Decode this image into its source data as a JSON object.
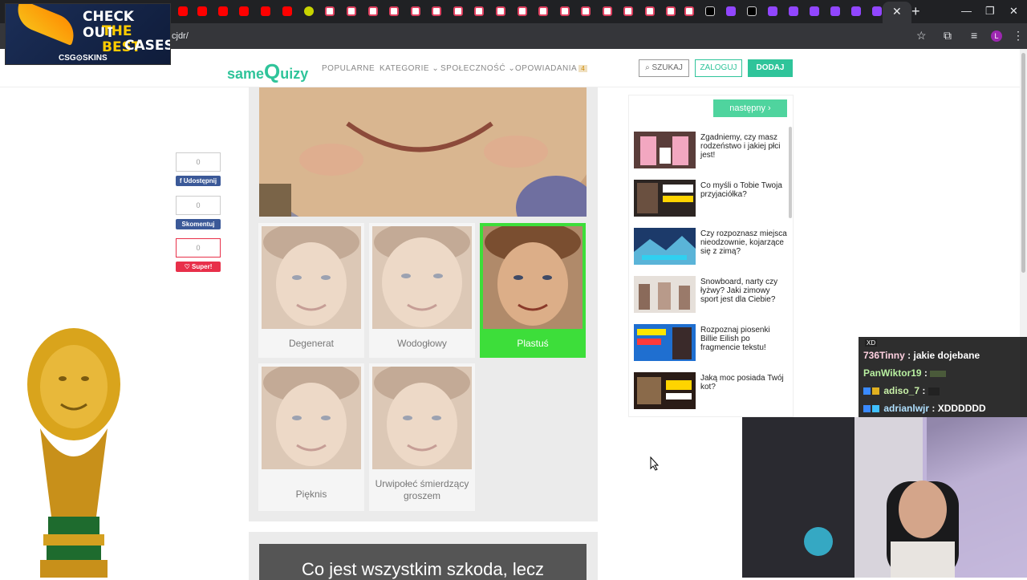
{
  "browser": {
    "url": "cjdr/",
    "profile_initial": "L",
    "tab_close": "✕",
    "new_tab": "+",
    "win_min": "—",
    "win_max": "❐",
    "win_close": "✕"
  },
  "ad": {
    "line1": "CHECK OUT",
    "line2": "THE BEST",
    "line3": "CASES",
    "brand": "CSG⊙SKINS"
  },
  "site": {
    "logo_small": "same",
    "logo_big": "Q",
    "logo_rest": "uizy",
    "nav": {
      "popular": "POPULARNE",
      "categories": "KATEGORIE",
      "community": "SPOŁECZNOŚĆ",
      "stories": "OPOWIADANIA",
      "stories_badge": "4"
    },
    "search": "SZUKAJ",
    "login": "ZALOGUJ",
    "add": "DODAJ"
  },
  "share": {
    "share_count": "0",
    "share_label": "Udostępnij",
    "comment_count": "0",
    "comment_label": "Skomentuj",
    "like_count": "0",
    "like_label": "Super!"
  },
  "quiz": {
    "answers": [
      {
        "label": "Degenerat",
        "selected": false
      },
      {
        "label": "Wodogłowy",
        "selected": false
      },
      {
        "label": "Plastuś",
        "selected": true
      },
      {
        "label": "Pięknis",
        "selected": false
      },
      {
        "label": "Urwipołeć śmierdzący groszem",
        "selected": false
      }
    ],
    "next_question_partial": "Co jest wszystkim szkoda, lecz"
  },
  "sidebar": {
    "next_button": "następny",
    "items": [
      {
        "title": "Zgadniemy, czy masz rodzeństwo i jakiej płci jest!"
      },
      {
        "title": "Co myśli o Tobie Twoja przyjaciółka?"
      },
      {
        "title": "Czy rozpoznasz miejsca nieodzownie, kojarzące się z zimą?"
      },
      {
        "title": "Snowboard, narty czy łyżwy? Jaki zimowy sport jest dla Ciebie?"
      },
      {
        "title": "Rozpoznaj piosenki Billie Eilish po fragmencie tekstu!"
      },
      {
        "title": "Jaką moc posiada Twój kot?"
      }
    ]
  },
  "chat": {
    "emote_top": "XD",
    "messages": [
      {
        "user": "736Tinny",
        "text": "jakie dojebane"
      },
      {
        "user": "PanWiktor19",
        "text": ""
      },
      {
        "user": "adiso_7",
        "text": ""
      },
      {
        "user": "adrianlwjr",
        "text": "XDDDDDD"
      }
    ]
  },
  "colors": {
    "brand_green": "#2fc49a",
    "selected_green": "#3dde3a",
    "facebook_blue": "#3b5998",
    "like_red": "#e8304a"
  }
}
